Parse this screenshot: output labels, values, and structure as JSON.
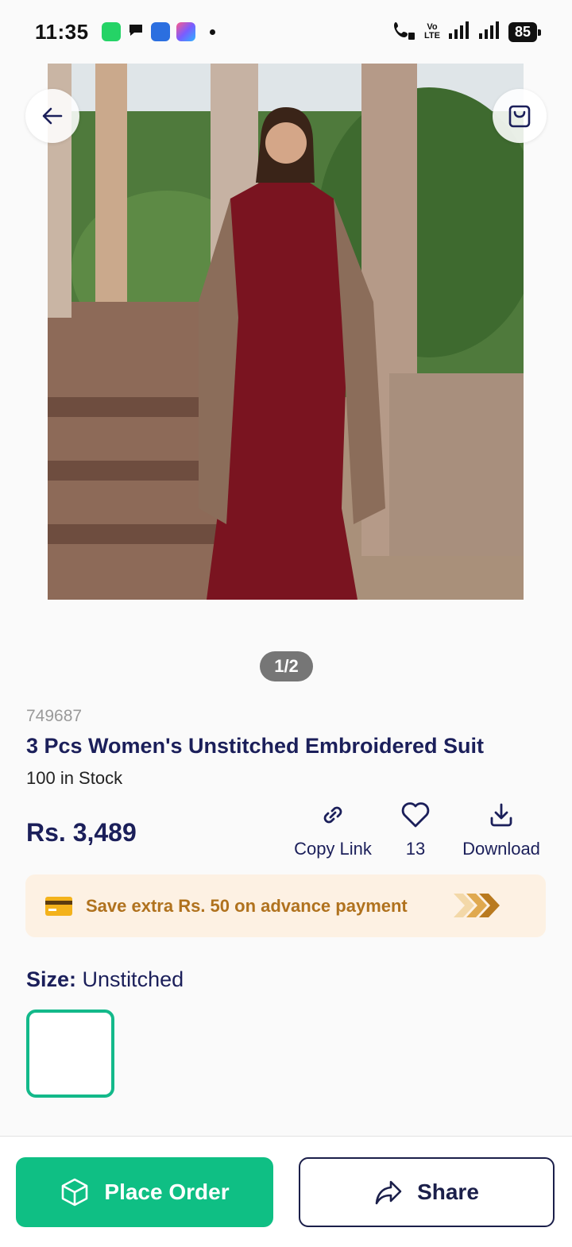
{
  "status_bar": {
    "time": "11:35",
    "battery": "85",
    "network_label_top": "Vo",
    "network_label_bottom": "LTE"
  },
  "gallery": {
    "pager": "1/2"
  },
  "product": {
    "sku": "749687",
    "title": "3 Pcs Women's Unstitched Embroidered Suit",
    "stock": "100 in Stock",
    "price": "Rs. 3,489"
  },
  "actions": {
    "copy_link": "Copy Link",
    "likes": "13",
    "download": "Download"
  },
  "promo": {
    "text": "Save extra Rs. 50 on advance payment"
  },
  "size": {
    "label": "Size:",
    "value": "Unstitched"
  },
  "footer": {
    "place_order": "Place Order",
    "share": "Share"
  },
  "colors": {
    "primary_green": "#0fbf84",
    "navy": "#1b1f5a",
    "promo_bg": "#fdf1e3",
    "promo_text": "#b0721e"
  }
}
